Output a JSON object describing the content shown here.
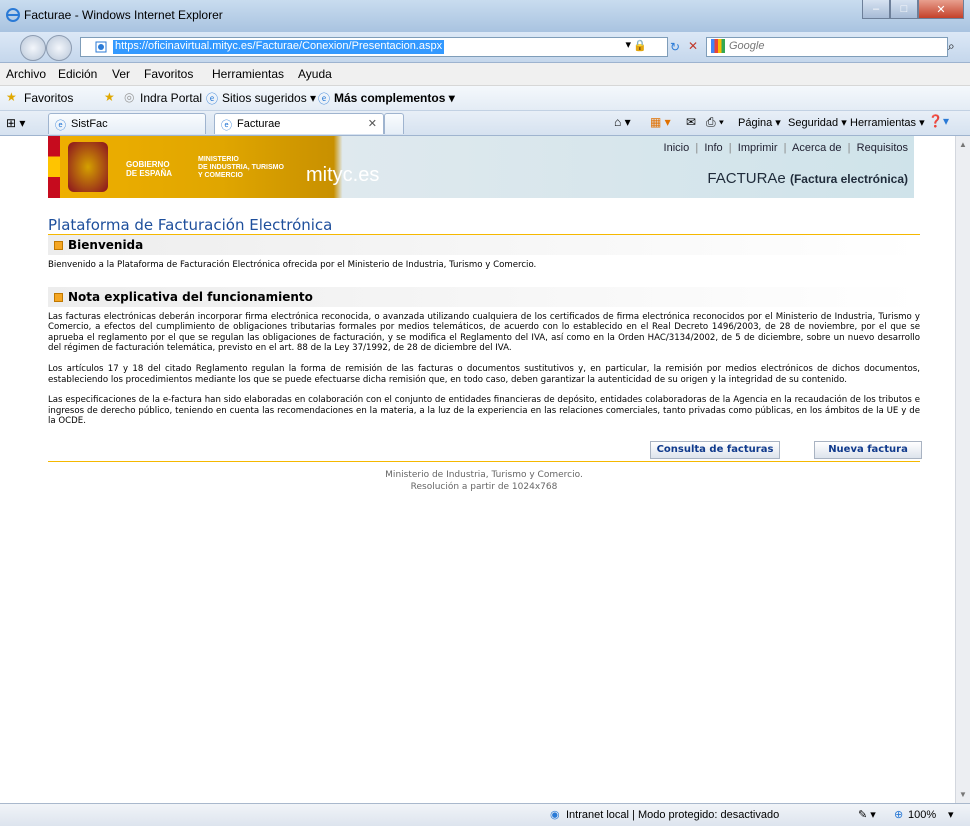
{
  "window": {
    "title": "Facturae - Windows Internet Explorer"
  },
  "address": {
    "url": "https://oficinavirtual.mityc.es/Facturae/Conexion/Presentacion.aspx",
    "search_placeholder": "Google"
  },
  "menu": [
    "Archivo",
    "Edición",
    "Ver",
    "Favoritos",
    "Herramientas",
    "Ayuda"
  ],
  "favorites": {
    "favoritos": "Favoritos",
    "indra": "Indra Portal",
    "sugeridos": "Sitios sugeridos ▾",
    "complementos": "Más complementos ▾"
  },
  "tabs": {
    "tab1": "SistFac",
    "tab2": "Facturae"
  },
  "command_bar": {
    "pagina": "Página ▾",
    "seguridad": "Seguridad ▾",
    "herramientas": "Herramientas ▾"
  },
  "banner": {
    "gobierno": "GOBIERNO\nDE ESPAÑA",
    "ministerio": "MINISTERIO\nDE INDUSTRIA, TURISMO\nY COMERCIO",
    "mityc": "mityc.es",
    "nav": [
      "Inicio",
      "Info",
      "Imprimir",
      "Acerca de",
      "Requisitos"
    ],
    "brand": "FACTURAe",
    "brand_sub": "(Factura electrónica)"
  },
  "page": {
    "title": "Plataforma de Facturación Electrónica",
    "section1": "Bienvenida",
    "welcome": "Bienvenido a la Plataforma de Facturación Electrónica ofrecida por el Ministerio de Industria, Turismo y Comercio.",
    "section2": "Nota explicativa del funcionamiento",
    "p1": "Las facturas electrónicas deberán incorporar firma electrónica reconocida, o avanzada utilizando cualquiera de los certificados de firma electrónica reconocidos por el Ministerio de Industria, Turismo y Comercio, a efectos del cumplimiento de obligaciones tributarias formales por medios telemáticos, de acuerdo con lo establecido en el Real Decreto 1496/2003, de 28 de noviembre, por el que se aprueba el reglamento por el que se regulan las obligaciones de facturación, y se modifica el Reglamento del IVA, así como en la Orden HAC/3134/2002, de 5 de diciembre, sobre un nuevo desarrollo del régimen de facturación telemática, previsto en el art. 88 de la Ley 37/1992, de 28 de diciembre del IVA.",
    "p2": "Los artículos 17 y 18 del citado Reglamento regulan la forma de remisión de las facturas o documentos sustitutivos y, en particular, la remisión por medios electrónicos de dichos documentos, estableciendo los procedimientos mediante los que se puede efectuarse dicha remisión que, en todo caso, deben garantizar la autenticidad de su origen y la integridad de su contenido.",
    "p3": "Las especificaciones de la e-factura han sido elaboradas en colaboración con el conjunto de entidades financieras de depósito, entidades colaboradoras de la Agencia en la recaudación de los tributos e ingresos de derecho público, teniendo en cuenta las recomendaciones en la materia, a la luz de la experiencia en las relaciones comerciales, tanto privadas como públicas, en los ámbitos de la UE y de la OCDE.",
    "btn_consulta": "Consulta de facturas",
    "btn_nueva": "Nueva factura",
    "footer1": "Ministerio de Industria, Turismo y Comercio.",
    "footer2": "Resolución a partir de 1024x768"
  },
  "status": {
    "zone": "Intranet local | Modo protegido: desactivado",
    "zoom": "100%"
  }
}
